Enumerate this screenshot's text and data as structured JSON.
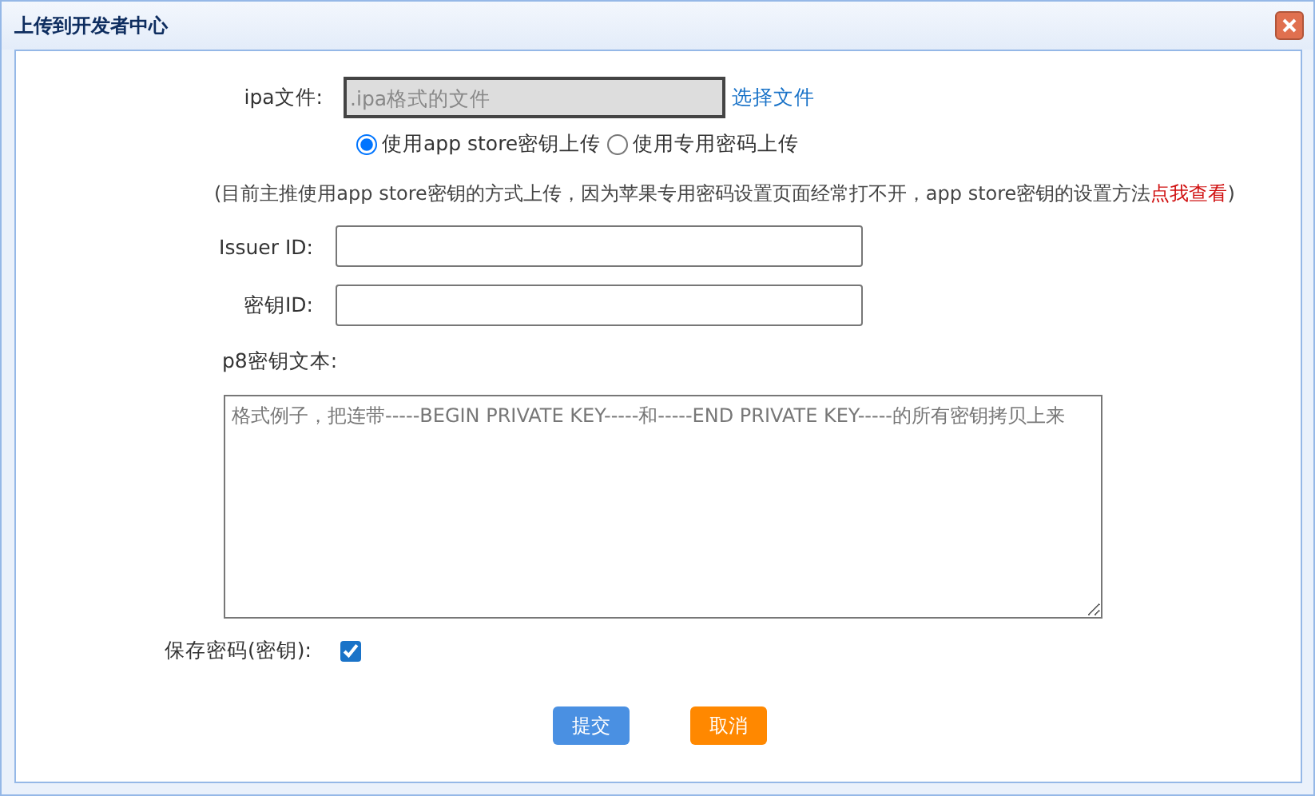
{
  "window": {
    "title": "上传到开发者中心"
  },
  "file_field": {
    "label": "ipa文件:",
    "placeholder": ".ipa格式的文件",
    "choose_link": "选择文件"
  },
  "upload_modes": [
    {
      "label": "使用app store密钥上传",
      "selected": true
    },
    {
      "label": "使用专用密码上传",
      "selected": false
    }
  ],
  "note": {
    "text": "(目前主推使用app store密钥的方式上传，因为苹果专用密码设置页面经常打不开，app store密钥的设置方法",
    "link": "点我查看",
    "closing": ")"
  },
  "fields": [
    {
      "label": "Issuer ID:"
    },
    {
      "label": "密钥ID:"
    }
  ],
  "p8_key": {
    "label": "p8密钥文本:",
    "placeholder": "格式例子，把连带-----BEGIN PRIVATE KEY-----和-----END PRIVATE KEY-----的所有密钥拷贝上来"
  },
  "save_password": {
    "label": "保存密码(密钥):",
    "checked": true
  },
  "buttons": [
    {
      "label": "提交",
      "kind": "submit"
    },
    {
      "label": "取消",
      "kind": "cancel"
    }
  ]
}
